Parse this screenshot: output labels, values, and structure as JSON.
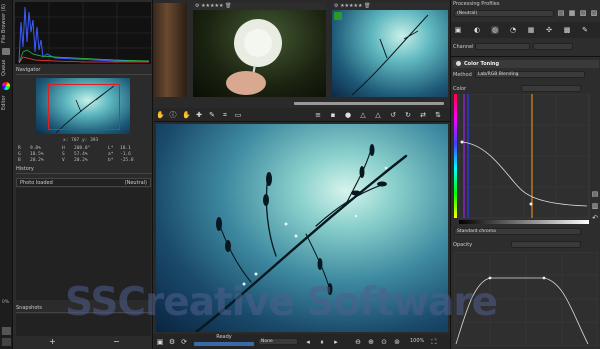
{
  "left_tabs": {
    "file_browser": "File Browser (6)",
    "queue": "Queue",
    "editor": "Editor"
  },
  "navigator": {
    "title": "Navigator",
    "coords": "x: 707 y: 393",
    "readout": [
      [
        "R",
        "9.8%",
        "H",
        "208.0°",
        "L*",
        "18.1"
      ],
      [
        "G",
        "18.5%",
        "S",
        "57.4%",
        "a*",
        "-1.6"
      ],
      [
        "B",
        "20.2%",
        "V",
        "20.2%",
        "b*",
        "-25.8"
      ]
    ]
  },
  "history": {
    "title": "History",
    "row_label": "Photo loaded",
    "row_value": "(Neutral)"
  },
  "snapshots": {
    "title": "Snapshots",
    "add": "+",
    "remove": "−"
  },
  "left_percent": "0%",
  "status": {
    "ready": "Ready",
    "none_label": "None",
    "zoom": "100%"
  },
  "right": {
    "profiles_title": "Processing Profiles",
    "profile_value": "(Neutral)",
    "channel_label": "Channel",
    "color_toning_title": "Color Toning",
    "method_label": "Method",
    "method_value": "Lab/RGB Blending",
    "color_label": "Color",
    "standard_chroma": "Standard chroma",
    "opacity_label": "Opacity"
  },
  "watermark": "SSCreative Software",
  "colors": {
    "accent_purple": "#a020f0",
    "accent_blue": "#2040ff",
    "accent_orange": "#e08a20"
  },
  "icons": [
    "gear-icon",
    "info-icon",
    "crop-icon",
    "hand-icon",
    "warning-icon",
    "rotate-icon",
    "zoom-in-icon",
    "zoom-out-icon"
  ]
}
